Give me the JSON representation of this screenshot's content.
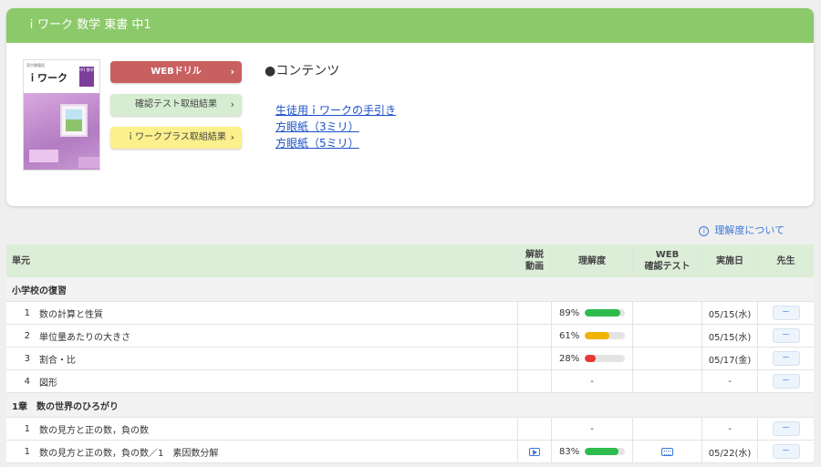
{
  "header": {
    "title": "ｉワーク 数学 東書 中1"
  },
  "book": {
    "small_text": "東京書籍版",
    "title": "ｉワーク",
    "badge": "中1 数学"
  },
  "buttons": {
    "web_drill": "WEBドリル",
    "test_results": "確認テスト取組結果",
    "plus_results": "ｉワークプラス取組結果"
  },
  "contents": {
    "title": "●コンテンツ",
    "links": [
      "生徒用ｉワークの手引き",
      "方眼紙（3ミリ）",
      "方眼紙（5ミリ）"
    ]
  },
  "about_link": "理解度について",
  "table": {
    "headers": {
      "unit": "単元",
      "video": "解説\n動画",
      "understanding": "理解度",
      "web_test": "WEB\n確認テスト",
      "date": "実施日",
      "teacher": "先生"
    },
    "sections": [
      {
        "title": "小学校の復習",
        "rows": [
          {
            "num": "1",
            "name": "数の計算と性質",
            "video": false,
            "pct_text": "89%",
            "pct": 89,
            "color": "#2ebc4f",
            "web_test": false,
            "date": "05/15(水)",
            "teacher": "－"
          },
          {
            "num": "2",
            "name": "単位量あたりの大きさ",
            "video": false,
            "pct_text": "61%",
            "pct": 61,
            "color": "#f0b400",
            "web_test": false,
            "date": "05/15(水)",
            "teacher": "－"
          },
          {
            "num": "3",
            "name": "割合・比",
            "video": false,
            "pct_text": "28%",
            "pct": 28,
            "color": "#e53935",
            "web_test": false,
            "date": "05/17(金)",
            "teacher": "－"
          },
          {
            "num": "4",
            "name": "図形",
            "video": false,
            "pct_text": "-",
            "pct": null,
            "color": "",
            "web_test": false,
            "date": "-",
            "teacher": "－"
          }
        ]
      },
      {
        "title": "1章　数の世界のひろがり",
        "rows": [
          {
            "num": "1",
            "name": "数の見方と正の数，負の数",
            "video": false,
            "pct_text": "-",
            "pct": null,
            "color": "",
            "web_test": false,
            "date": "-",
            "teacher": "－"
          },
          {
            "num": "1",
            "name": "数の見方と正の数，負の数／1　素因数分解",
            "video": true,
            "pct_text": "83%",
            "pct": 83,
            "color": "#2ebc4f",
            "web_test": true,
            "date": "05/22(水)",
            "teacher": "－"
          }
        ]
      }
    ]
  }
}
